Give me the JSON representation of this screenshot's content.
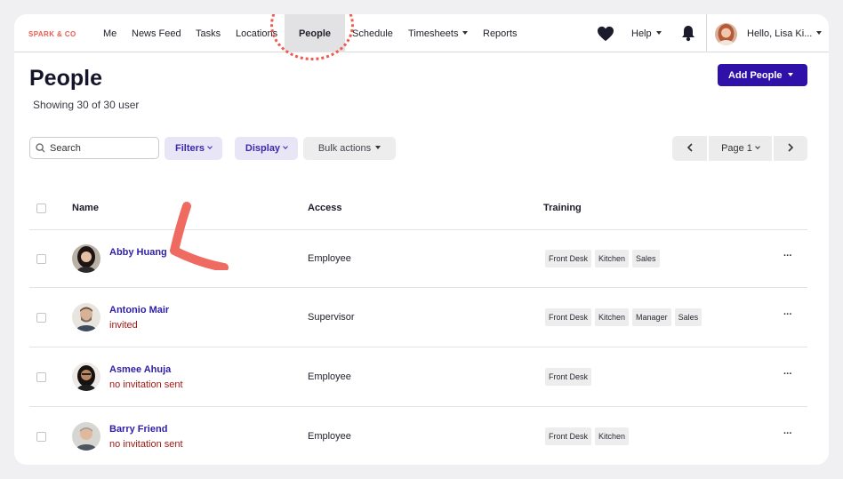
{
  "brand": {
    "logo_text": "SPARK & CO",
    "accent": "#ef5a4f"
  },
  "nav": {
    "items": [
      {
        "label": "Me"
      },
      {
        "label": "News Feed"
      },
      {
        "label": "Tasks"
      },
      {
        "label": "Locations"
      },
      {
        "label": "People",
        "active": true
      },
      {
        "label": "Schedule"
      },
      {
        "label": "Timesheets",
        "has_dropdown": true
      },
      {
        "label": "Reports"
      }
    ],
    "help_label": "Help",
    "user_greeting": "Hello, Lisa Ki..."
  },
  "page": {
    "title": "People",
    "subtitle": "Showing 30 of 30 user",
    "add_button": "Add People",
    "primary_color": "#2f10a8"
  },
  "toolbar": {
    "search_placeholder": "Search",
    "filters_label": "Filters",
    "display_label": "Display",
    "bulk_label": "Bulk actions",
    "page_label": "Page 1"
  },
  "table": {
    "headers": {
      "name": "Name",
      "access": "Access",
      "training": "Training"
    },
    "rows": [
      {
        "name": "Abby Huang",
        "status": "",
        "access": "Employee",
        "training": [
          "Front Desk",
          "Kitchen",
          "Sales"
        ]
      },
      {
        "name": "Antonio Mair",
        "status": "invited",
        "access": "Supervisor",
        "training": [
          "Front Desk",
          "Kitchen",
          "Manager",
          "Sales"
        ]
      },
      {
        "name": "Asmee Ahuja",
        "status": "no invitation sent",
        "access": "Employee",
        "training": [
          "Front Desk"
        ]
      },
      {
        "name": "Barry Friend",
        "status": "no invitation sent",
        "access": "Employee",
        "training": [
          "Front Desk",
          "Kitchen"
        ]
      }
    ],
    "more_label": "···"
  },
  "icons": {
    "heart": "heart-icon",
    "bell": "bell-icon",
    "search": "search-icon",
    "chevron_left": "chevron-left-icon",
    "chevron_right": "chevron-right-icon"
  }
}
